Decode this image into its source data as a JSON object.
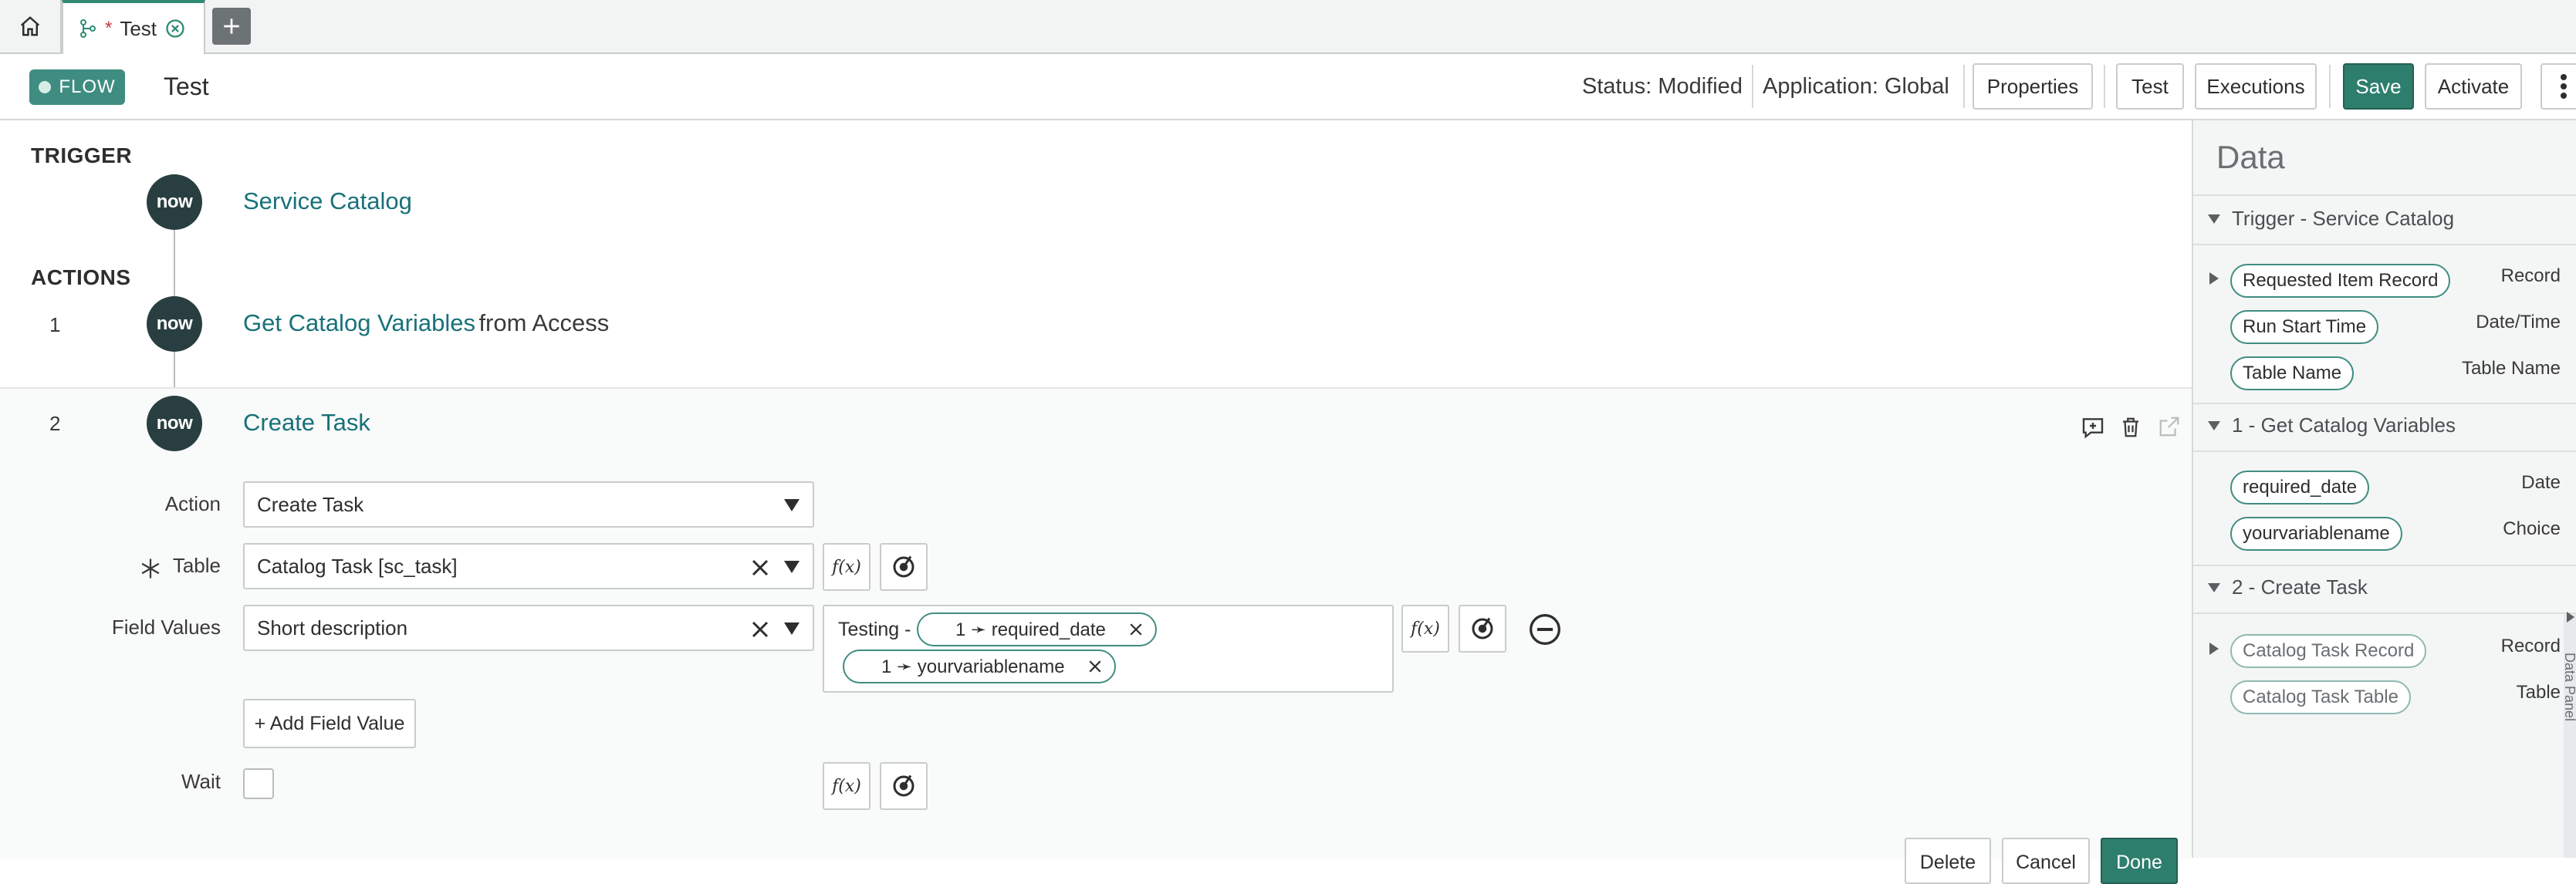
{
  "tabs": {
    "home_icon": "home-icon",
    "active": {
      "icon": "flow-icon",
      "modified_mark": "*",
      "label": "Test"
    },
    "add_icon": "plus-icon"
  },
  "header": {
    "badge": "FLOW",
    "title": "Test",
    "status": "Status: Modified",
    "application": "Application: Global",
    "buttons": {
      "properties": "Properties",
      "test": "Test",
      "executions": "Executions",
      "save": "Save",
      "activate": "Activate"
    }
  },
  "flow": {
    "trigger_label": "TRIGGER",
    "trigger": {
      "logo": "now",
      "name": "Service Catalog"
    },
    "actions_label": "ACTIONS",
    "actions": [
      {
        "number": "1",
        "logo": "now",
        "name": "Get Catalog Variables",
        "suffix": "from Access"
      },
      {
        "number": "2",
        "logo": "now",
        "name": "Create Task"
      }
    ]
  },
  "create_task": {
    "action_label": "Action",
    "action_value": "Create Task",
    "table_label": "Table",
    "table_value": "Catalog Task [sc_task]",
    "field_values_label": "Field Values",
    "field_name": "Short description",
    "field_value_prefix": "Testing -",
    "pills": [
      "1 ➛ required_date",
      "1 ➛ yourvariablename"
    ],
    "add_field_button": "+ Add Field Value",
    "wait_label": "Wait",
    "fx": "f(x)",
    "bottom_buttons": {
      "delete": "Delete",
      "cancel": "Cancel",
      "done": "Done"
    }
  },
  "data_panel": {
    "title": "Data",
    "sections": [
      {
        "title": "Trigger - Service Catalog",
        "items": [
          {
            "label": "Requested Item Record",
            "type": "Record",
            "expandable": true
          },
          {
            "label": "Run Start Time",
            "type": "Date/Time",
            "expandable": false
          },
          {
            "label": "Table Name",
            "type": "Table Name",
            "expandable": false
          }
        ]
      },
      {
        "title": "1 - Get Catalog Variables",
        "items": [
          {
            "label": "required_date",
            "type": "Date",
            "expandable": false
          },
          {
            "label": "yourvariablename",
            "type": "Choice",
            "expandable": false
          }
        ]
      },
      {
        "title": "2 - Create Task",
        "items": [
          {
            "label": "Catalog Task Record",
            "type": "Record",
            "expandable": true
          },
          {
            "label": "Catalog Task Table",
            "type": "Table",
            "expandable": false
          }
        ]
      }
    ],
    "side_tab": "Data Panel"
  },
  "colors": {
    "accent": "#2d7e6d",
    "link": "#18717a",
    "now_logo_bg": "#293e40"
  }
}
